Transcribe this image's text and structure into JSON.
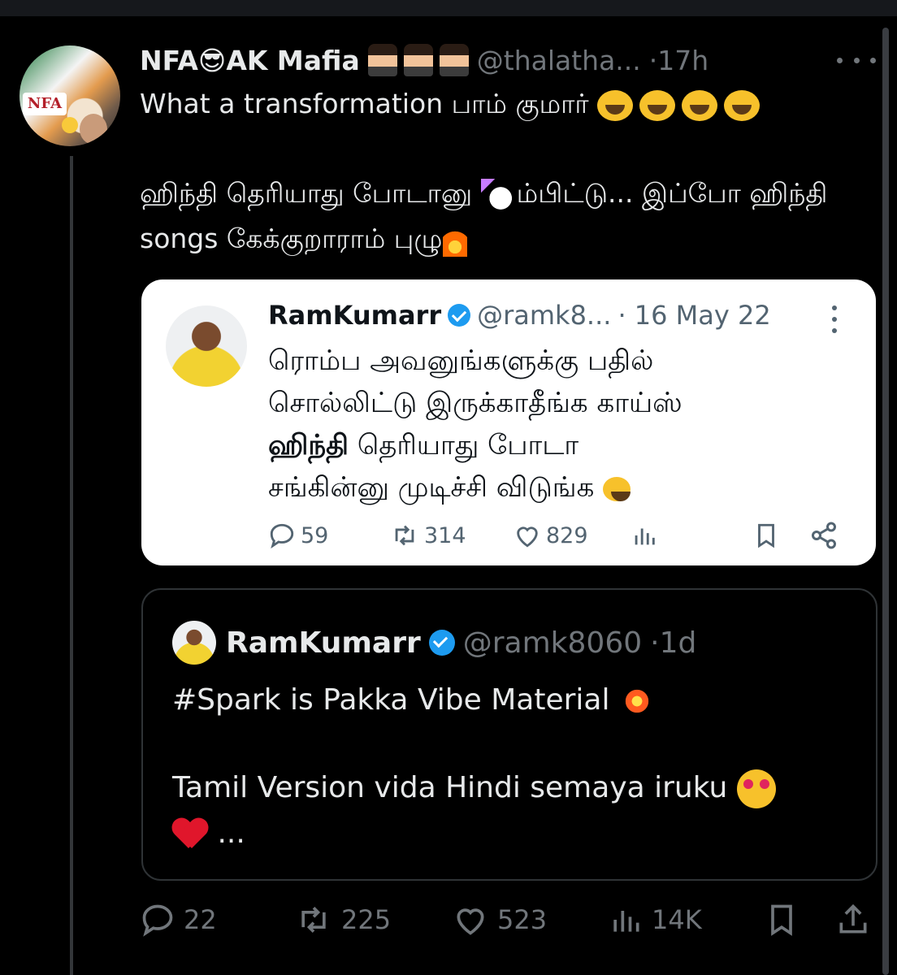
{
  "tweet": {
    "display_name": "NFA😎AK Mafia",
    "handle": "@thalatha...",
    "time": "·17h",
    "avatar_label": "NFA",
    "text_line1": "What a transformation பாம் குமார்",
    "text_p2_a": "ஹிந்தி தெரியாது போடானு ",
    "text_p2_b": "ம்பிட்டு... இப்போ ஹிந்தி songs கேக்குறாராம் புழு",
    "actions": {
      "replies": "22",
      "retweets": "225",
      "likes": "523",
      "views": "14K"
    }
  },
  "quoted_old": {
    "display_name": "RamKumarr",
    "handle": "@ramk8...",
    "time": "· 16 May 22",
    "text_line1": "ரொம்ப அவனுங்களுக்கு பதில்",
    "text_line2": "சொல்லிட்டு இருக்காதீங்க காய்ஸ்",
    "text_bold": "ஹிந்தி",
    "text_line3_rest": " தெரியாது போடா",
    "text_line4": "சங்கின்னு முடிச்சி விடுங்க",
    "actions": {
      "replies": "59",
      "retweets": "314",
      "likes": "829"
    }
  },
  "quoted_new": {
    "display_name": "RamKumarr",
    "handle": "@ramk8060",
    "time": "·1d",
    "text_line1": "#Spark is Pakka Vibe Material",
    "text_line2": "Tamil Version vida Hindi semaya iruku",
    "ellipsis": "..."
  },
  "icons": {
    "more": "more-icon",
    "verified": "verified-icon",
    "reply": "reply-icon",
    "retweet": "retweet-icon",
    "like": "like-icon",
    "views": "views-icon",
    "bookmark": "bookmark-icon",
    "share": "share-icon"
  },
  "colors": {
    "background": "#000000",
    "text": "#e7e9ea",
    "muted": "#71767b",
    "verified": "#1d9bf0",
    "card_light_bg": "#ffffff"
  }
}
